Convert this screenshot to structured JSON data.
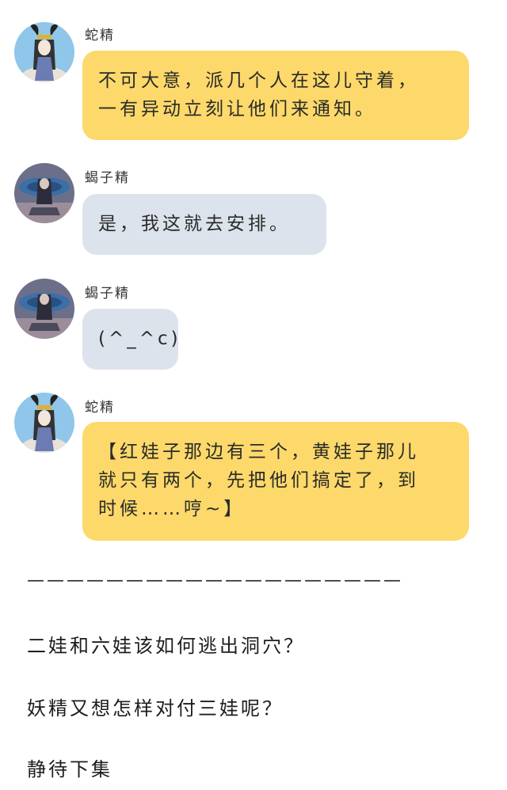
{
  "messages": [
    {
      "sender": "蛇精",
      "avatar_icon": "snake-spirit-avatar",
      "bubble_color": "#fcd96a",
      "lines": [
        "不可大意，派几个人在这儿守着，",
        "一有异动立刻让他们来通知。"
      ]
    },
    {
      "sender": "蝎子精",
      "avatar_icon": "scorpion-spirit-avatar",
      "bubble_color": "#dde3ec",
      "lines": [
        "是，我这就去安排。"
      ]
    },
    {
      "sender": "蝎子精",
      "avatar_icon": "scorpion-spirit-avatar",
      "bubble_color": "#dde3ec",
      "lines": [
        "(^_^c)"
      ]
    },
    {
      "sender": "蛇精",
      "avatar_icon": "snake-spirit-avatar",
      "bubble_color": "#fcd96a",
      "lines": [
        "【红娃子那边有三个，黄娃子那儿",
        "就只有两个，先把他们搞定了，到",
        "时候……哼~】"
      ]
    }
  ],
  "divider": "———————————————————",
  "footer": [
    "二娃和六娃该如何逃出洞穴？",
    "妖精又想怎样对付三娃呢？",
    "静待下集"
  ]
}
